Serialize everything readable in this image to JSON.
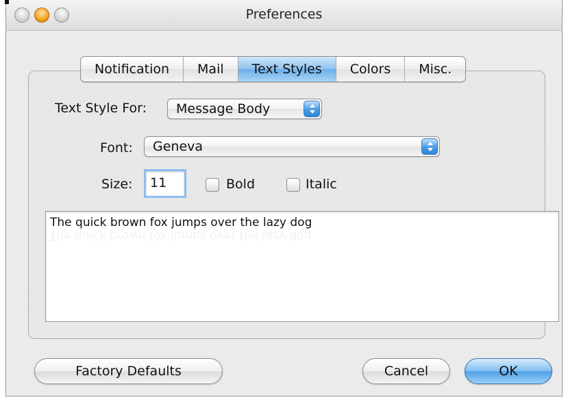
{
  "window": {
    "title": "Preferences"
  },
  "tabs": [
    {
      "label": "Notification",
      "selected": false
    },
    {
      "label": "Mail",
      "selected": false
    },
    {
      "label": "Text Styles",
      "selected": true
    },
    {
      "label": "Colors",
      "selected": false
    },
    {
      "label": "Misc.",
      "selected": false
    }
  ],
  "form": {
    "text_style_for_label": "Text Style For:",
    "text_style_for_value": "Message Body",
    "font_label": "Font:",
    "font_value": "Geneva",
    "size_label": "Size:",
    "size_value": "11",
    "bold_label": "Bold",
    "bold_checked": false,
    "italic_label": "Italic",
    "italic_checked": false
  },
  "preview": {
    "text": "The quick brown fox jumps over the lazy dog"
  },
  "buttons": {
    "factory_defaults": "Factory Defaults",
    "cancel": "Cancel",
    "ok": "OK"
  },
  "colors": {
    "accent": "#6aaee9",
    "popup_arrow": "#4a9ae3"
  }
}
